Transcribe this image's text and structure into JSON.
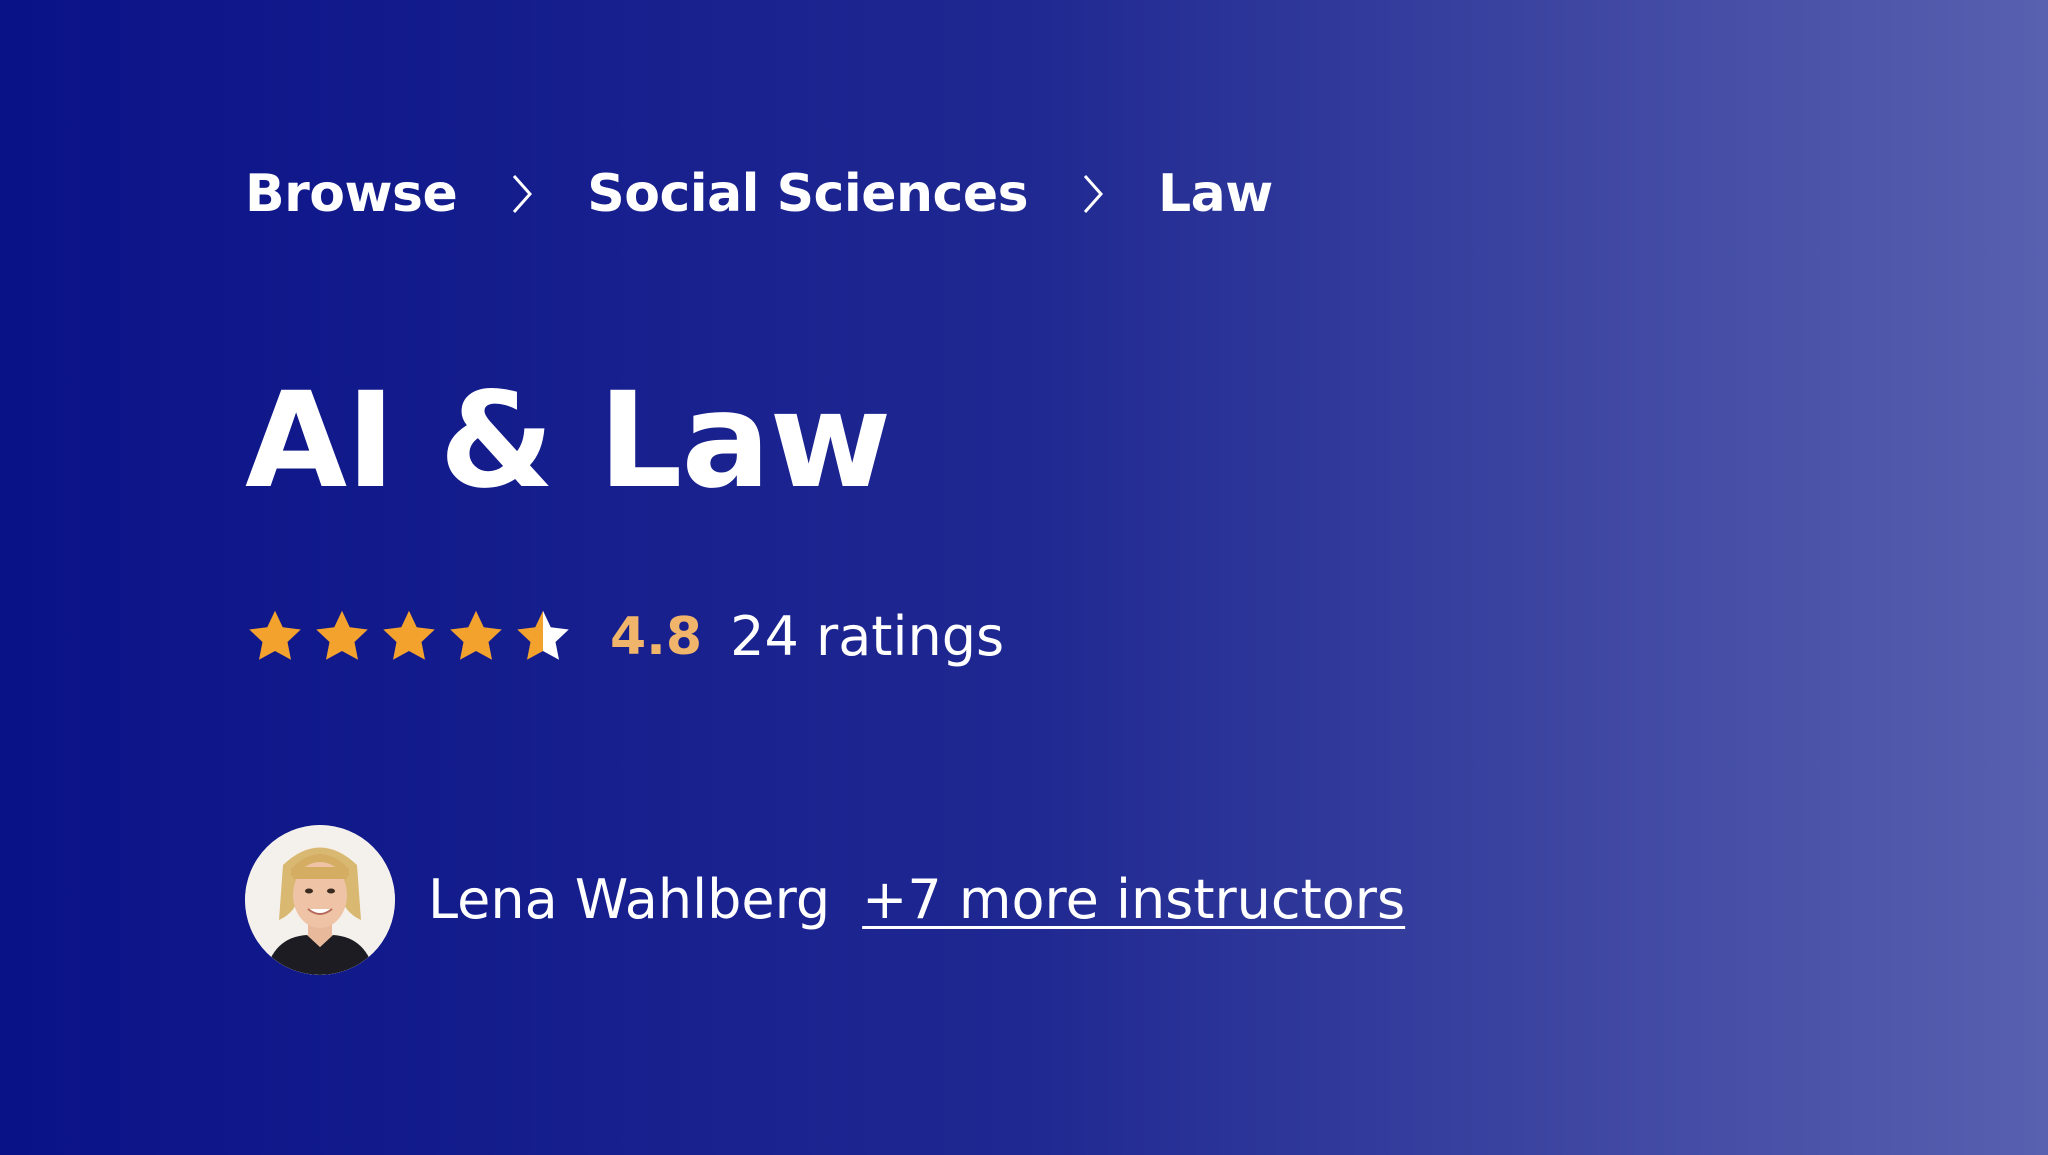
{
  "colors": {
    "background_start": "#0a1288",
    "background_end": "#5860b0",
    "text": "#ffffff",
    "rating_value": "#f0b56a",
    "star": "#f2a22d"
  },
  "breadcrumb": {
    "items": [
      {
        "label": "Browse"
      },
      {
        "label": "Social Sciences"
      },
      {
        "label": "Law"
      }
    ],
    "separator_icon": "chevron-right-icon"
  },
  "course": {
    "title": "AI & Law"
  },
  "rating": {
    "value": "4.8",
    "stars_filled": 4.5,
    "stars_max": 5,
    "count_text": "24 ratings",
    "star_icon": "star-icon"
  },
  "instructors": {
    "primary_name": "Lena Wahlberg",
    "more_link_text": "+7 more instructors"
  }
}
